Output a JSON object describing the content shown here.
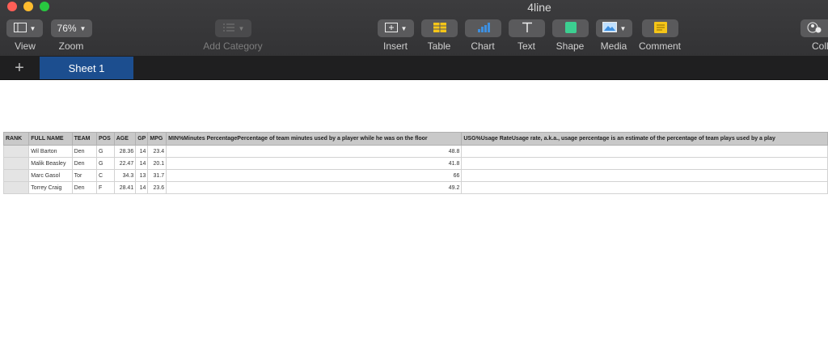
{
  "window": {
    "title": "4line"
  },
  "toolbar": {
    "view": "View",
    "zoom_value": "76%",
    "zoom": "Zoom",
    "add_category": "Add Category",
    "insert": "Insert",
    "table": "Table",
    "chart": "Chart",
    "text": "Text",
    "shape": "Shape",
    "media": "Media",
    "comment": "Comment",
    "collaborate": "Collabo"
  },
  "tabs": {
    "add": "+",
    "sheet1": "Sheet 1"
  },
  "table": {
    "headers": [
      "RANK",
      "FULL NAME",
      "TEAM",
      "POS",
      "AGE",
      "GP",
      "MPG",
      "MIN%Minutes PercentagePercentage of team minutes used by a player while he was on the floor",
      "USG%Usage RateUsage rate, a.k.a., usage percentage is an estimate of the percentage of team plays used by a play"
    ],
    "rows": [
      {
        "rank": "",
        "name": "Wil Barton",
        "team": "Den",
        "pos": "G",
        "age": "28.36",
        "gp": "14",
        "mpg": "23.4",
        "min": "48.8",
        "usg": ""
      },
      {
        "rank": "",
        "name": "Malik Beasley",
        "team": "Den",
        "pos": "G",
        "age": "22.47",
        "gp": "14",
        "mpg": "20.1",
        "min": "41.8",
        "usg": ""
      },
      {
        "rank": "",
        "name": "Marc Gasol",
        "team": "Tor",
        "pos": "C",
        "age": "34.3",
        "gp": "13",
        "mpg": "31.7",
        "min": "66",
        "usg": ""
      },
      {
        "rank": "",
        "name": "Torrey Craig",
        "team": "Den",
        "pos": "F",
        "age": "28.41",
        "gp": "14",
        "mpg": "23.6",
        "min": "49.2",
        "usg": ""
      }
    ]
  }
}
